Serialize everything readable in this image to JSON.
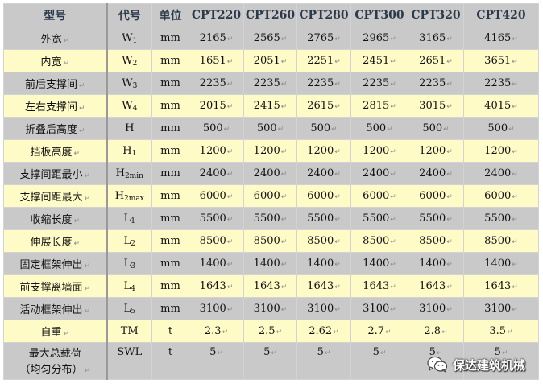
{
  "table": {
    "headers": [
      "型号",
      "代号",
      "单位",
      "CPT220",
      "CPT260",
      "CPT280",
      "CPT300",
      "CPT320",
      "CPT420"
    ],
    "rows": [
      {
        "name": "外宽",
        "code": "W",
        "sub": "1",
        "unit": "mm",
        "values": [
          "2165",
          "2565",
          "2765",
          "2965",
          "3165",
          "4165"
        ],
        "style": "gray"
      },
      {
        "name": "内宽",
        "code": "W",
        "sub": "2",
        "unit": "mm",
        "values": [
          "1651",
          "2051",
          "2251",
          "2451",
          "2651",
          "3651"
        ],
        "style": "yellow"
      },
      {
        "name": "前后支撑间",
        "code": "W",
        "sub": "3",
        "unit": "mm",
        "values": [
          "2235",
          "2235",
          "2235",
          "2235",
          "2235",
          "2235"
        ],
        "style": "gray"
      },
      {
        "name": "左右支撑间",
        "code": "W",
        "sub": "4",
        "unit": "mm",
        "values": [
          "2015",
          "2415",
          "2615",
          "2815",
          "3015",
          "4015"
        ],
        "style": "yellow"
      },
      {
        "name": "折叠后高度",
        "code": "H",
        "sub": "",
        "unit": "mm",
        "values": [
          "500",
          "500",
          "500",
          "500",
          "500",
          "500"
        ],
        "style": "gray"
      },
      {
        "name": "挡板高度",
        "code": "H",
        "sub": "1",
        "unit": "mm",
        "values": [
          "1200",
          "1200",
          "1200",
          "1200",
          "1200",
          "1200"
        ],
        "style": "yellow"
      },
      {
        "name": "支撑间距最小",
        "code": "H",
        "sub": "2min",
        "unit": "mm",
        "values": [
          "2400",
          "2400",
          "2400",
          "2400",
          "2400",
          "2400"
        ],
        "style": "gray"
      },
      {
        "name": "支撑间距最大",
        "code": "H",
        "sub": "2max",
        "unit": "mm",
        "values": [
          "6000",
          "6000",
          "6000",
          "6000",
          "6000",
          "6000"
        ],
        "style": "yellow"
      },
      {
        "name": "收缩长度",
        "code": "L",
        "sub": "1",
        "unit": "mm",
        "values": [
          "5500",
          "5500",
          "5500",
          "5500",
          "5500",
          "5500"
        ],
        "style": "gray"
      },
      {
        "name": "伸展长度",
        "code": "L",
        "sub": "2",
        "unit": "mm",
        "values": [
          "8500",
          "8500",
          "8500",
          "8500",
          "8500",
          "8500"
        ],
        "style": "yellow"
      },
      {
        "name": "固定框架伸出",
        "code": "L",
        "sub": "3",
        "unit": "mm",
        "values": [
          "1400",
          "1400",
          "1400",
          "1400",
          "1400",
          "1400"
        ],
        "style": "gray"
      },
      {
        "name": "前支撑离墙面",
        "code": "L",
        "sub": "4",
        "unit": "mm",
        "values": [
          "1643",
          "1643",
          "1643",
          "1643",
          "1643",
          "1643"
        ],
        "style": "yellow"
      },
      {
        "name": "活动框架伸出",
        "code": "L",
        "sub": "5",
        "unit": "mm",
        "values": [
          "3100",
          "3100",
          "3100",
          "3100",
          "3100",
          "3100"
        ],
        "style": "gray"
      },
      {
        "name": "自重",
        "code": "TM",
        "sub": "",
        "unit": "t",
        "values": [
          "2.3",
          "2.5",
          "2.62",
          "2.7",
          "2.8",
          "3.5"
        ],
        "style": "yellow"
      },
      {
        "name": "最大总载荷\n（均匀分布）",
        "code": "SWL",
        "sub": "",
        "unit": "t",
        "values": [
          "5",
          "5",
          "5",
          "5",
          "5",
          "5"
        ],
        "style": "gray"
      }
    ],
    "return_mark": "↵",
    "colors": {
      "gray_row": "#c9c9c9",
      "yellow_row": "#fffbc6",
      "header_text": "#2b3a4a"
    }
  },
  "watermark": {
    "text": "保达建筑机械",
    "icon": "wechat-icon"
  }
}
